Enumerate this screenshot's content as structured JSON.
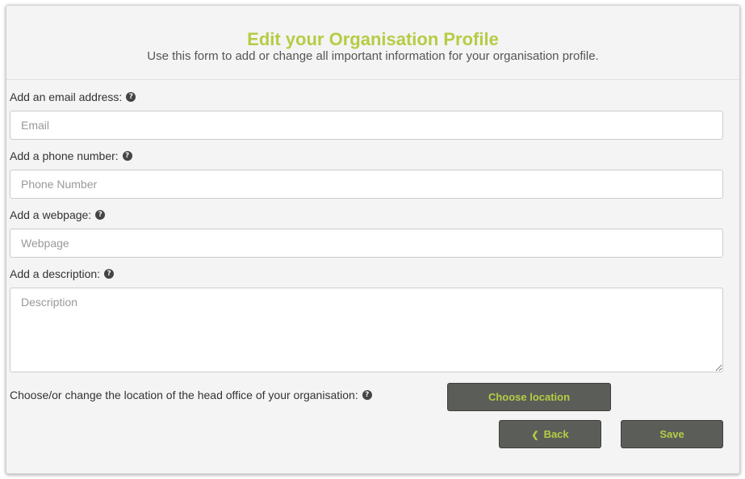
{
  "header": {
    "title": "Edit your Organisation Profile",
    "subtitle": "Use this form to add or change all important information for your organisation profile."
  },
  "form": {
    "email": {
      "label": "Add an email address:",
      "placeholder": "Email",
      "value": ""
    },
    "phone": {
      "label": "Add a phone number:",
      "placeholder": "Phone Number",
      "value": ""
    },
    "webpage": {
      "label": "Add a webpage:",
      "placeholder": "Webpage",
      "value": ""
    },
    "description": {
      "label": "Add a description:",
      "placeholder": "Description",
      "value": ""
    }
  },
  "location": {
    "label": "Choose/or change the location of the head office of your organisation:",
    "button_label": "Choose location"
  },
  "actions": {
    "back_label": "Back",
    "save_label": "Save"
  },
  "icons": {
    "help": "question-circle-icon",
    "back": "chevron-left-icon"
  },
  "colors": {
    "accent": "#b5cc45",
    "button_bg": "#5b5d58",
    "panel_bg": "#f4f4f4"
  }
}
